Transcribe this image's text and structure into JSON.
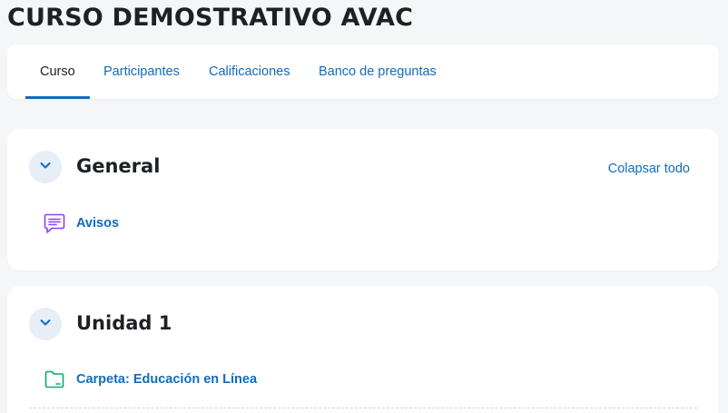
{
  "course": {
    "title": "CURSO DEMOSTRATIVO AVAC"
  },
  "tabs": [
    {
      "label": "Curso",
      "active": true
    },
    {
      "label": "Participantes",
      "active": false
    },
    {
      "label": "Calificaciones",
      "active": false
    },
    {
      "label": "Banco de preguntas",
      "active": false
    }
  ],
  "sections": [
    {
      "title": "General",
      "collapse_all_label": "Colapsar todo",
      "activities": [
        {
          "label": "Avisos",
          "icon": "forum-icon"
        }
      ]
    },
    {
      "title": "Unidad 1",
      "activities": [
        {
          "label": "Carpeta: Educación en Línea",
          "icon": "folder-icon"
        }
      ]
    }
  ],
  "colors": {
    "accent": "#0f6cbf",
    "background": "#f5f6f8",
    "forum_icon": "#8f3ff0",
    "folder_icon": "#11a676"
  }
}
